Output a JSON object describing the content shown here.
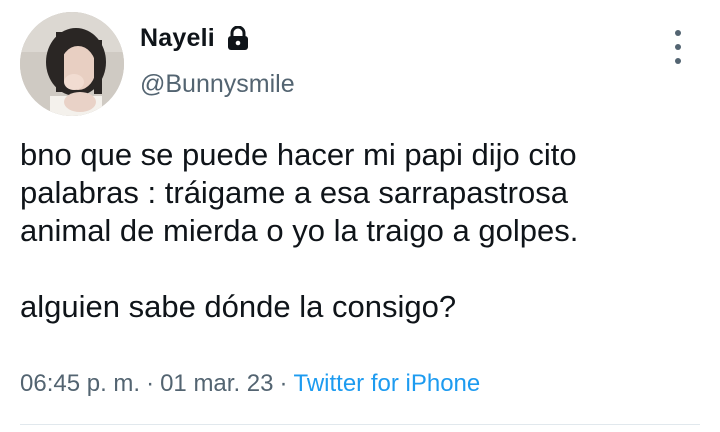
{
  "tweet": {
    "author": {
      "display_name": "Nayeli",
      "handle": "@Bunnysmile",
      "protected_icon": "lock-icon",
      "avatar": "profile-photo"
    },
    "more_icon": "more-vertical-icon",
    "text": "bno que se puede hacer mi papi dijo cito\npalabras : tráigame a esa sarrapastrosa\nanimal de mierda o yo la traigo a golpes.\n\nalguien sabe dónde la consigo?",
    "time": "06:45 p. m.",
    "separator": "·",
    "date": "01 mar. 23",
    "source": "Twitter for iPhone"
  },
  "colors": {
    "text_primary": "#0f1419",
    "text_secondary": "#536471",
    "link": "#1d9bf0",
    "divider": "#e1e8ed"
  }
}
